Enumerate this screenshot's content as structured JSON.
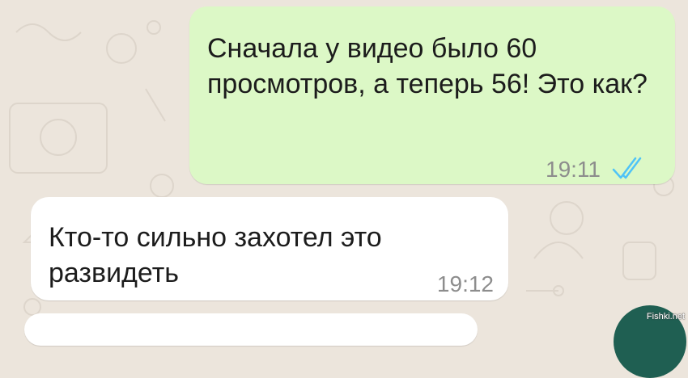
{
  "chat": {
    "messages": [
      {
        "direction": "outgoing",
        "text": "Сначала у видео было 60 просмотров, а теперь 56! Это как?",
        "time": "19:11",
        "status_icon": "double-check-read-icon"
      },
      {
        "direction": "incoming",
        "text": "Кто-то сильно захотел это развидеть",
        "time": "19:12"
      }
    ]
  },
  "watermark": "Fishki.net",
  "colors": {
    "background": "#ece5dc",
    "outgoing_bubble": "#dcf8c6",
    "incoming_bubble": "#ffffff",
    "read_ticks": "#4fc3f7",
    "fab": "#1f5f52"
  }
}
